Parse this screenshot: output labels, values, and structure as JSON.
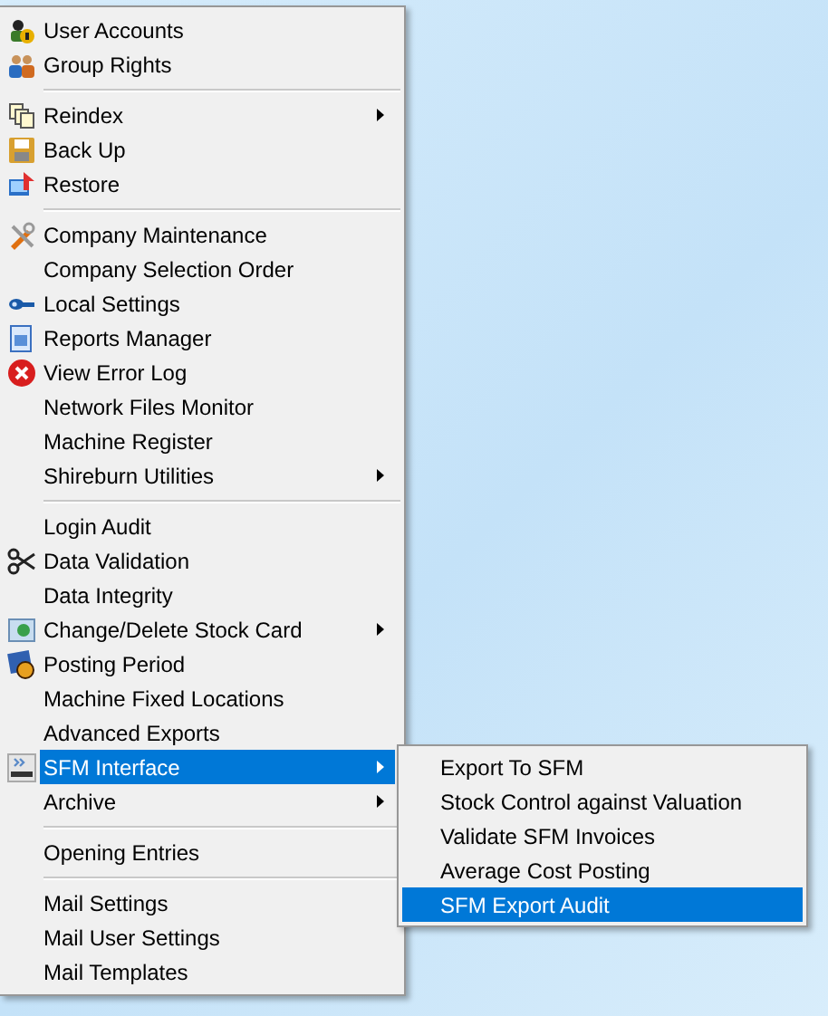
{
  "menu": {
    "sections": [
      [
        {
          "label": "User Accounts",
          "has_icon": true,
          "submenu": false,
          "selected": false
        },
        {
          "label": "Group Rights",
          "has_icon": true,
          "submenu": false,
          "selected": false
        }
      ],
      [
        {
          "label": "Reindex",
          "has_icon": true,
          "submenu": true,
          "selected": false
        },
        {
          "label": "Back Up",
          "has_icon": true,
          "submenu": false,
          "selected": false
        },
        {
          "label": "Restore",
          "has_icon": true,
          "submenu": false,
          "selected": false
        }
      ],
      [
        {
          "label": "Company Maintenance",
          "has_icon": true,
          "submenu": false,
          "selected": false
        },
        {
          "label": "Company Selection Order",
          "has_icon": false,
          "submenu": false,
          "selected": false
        },
        {
          "label": "Local Settings",
          "has_icon": true,
          "submenu": false,
          "selected": false
        },
        {
          "label": "Reports Manager",
          "has_icon": true,
          "submenu": false,
          "selected": false
        },
        {
          "label": "View Error Log",
          "has_icon": true,
          "submenu": false,
          "selected": false
        },
        {
          "label": "Network Files Monitor",
          "has_icon": false,
          "submenu": false,
          "selected": false
        },
        {
          "label": "Machine Register",
          "has_icon": false,
          "submenu": false,
          "selected": false
        },
        {
          "label": "Shireburn Utilities",
          "has_icon": false,
          "submenu": true,
          "selected": false
        }
      ],
      [
        {
          "label": "Login Audit",
          "has_icon": false,
          "submenu": false,
          "selected": false
        },
        {
          "label": "Data Validation",
          "has_icon": true,
          "submenu": false,
          "selected": false
        },
        {
          "label": "Data Integrity",
          "has_icon": false,
          "submenu": false,
          "selected": false
        },
        {
          "label": "Change/Delete Stock Card",
          "has_icon": true,
          "submenu": true,
          "selected": false
        },
        {
          "label": "Posting Period",
          "has_icon": true,
          "submenu": false,
          "selected": false
        },
        {
          "label": "Machine Fixed Locations",
          "has_icon": false,
          "submenu": false,
          "selected": false
        },
        {
          "label": "Advanced Exports",
          "has_icon": false,
          "submenu": false,
          "selected": false
        },
        {
          "label": "SFM Interface",
          "has_icon": true,
          "submenu": true,
          "selected": true
        },
        {
          "label": "Archive",
          "has_icon": false,
          "submenu": true,
          "selected": false
        }
      ],
      [
        {
          "label": "Opening Entries",
          "has_icon": false,
          "submenu": false,
          "selected": false
        }
      ],
      [
        {
          "label": "Mail Settings",
          "has_icon": false,
          "submenu": false,
          "selected": false
        },
        {
          "label": "Mail User Settings",
          "has_icon": false,
          "submenu": false,
          "selected": false
        },
        {
          "label": "Mail Templates",
          "has_icon": false,
          "submenu": false,
          "selected": false
        }
      ]
    ]
  },
  "submenu": {
    "items": [
      {
        "label": "Export To SFM",
        "selected": false
      },
      {
        "label": "Stock Control against Valuation",
        "selected": false
      },
      {
        "label": "Validate SFM Invoices",
        "selected": false
      },
      {
        "label": "Average Cost Posting",
        "selected": false
      },
      {
        "label": "SFM Export Audit",
        "selected": true
      }
    ]
  }
}
